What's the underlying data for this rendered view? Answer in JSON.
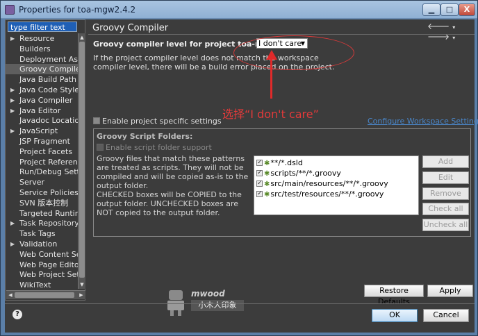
{
  "window": {
    "title": "Properties for toa-mgw2.4.2",
    "minimize_label": "▁",
    "maximize_label": "□",
    "close_label": "X"
  },
  "filter": {
    "text": "type filter text"
  },
  "tree": {
    "items": [
      {
        "label": "Resource",
        "expandable": true
      },
      {
        "label": "Builders",
        "expandable": false
      },
      {
        "label": "Deployment Assembly",
        "expandable": false
      },
      {
        "label": "Groovy Compiler",
        "expandable": false,
        "selected": true
      },
      {
        "label": "Java Build Path",
        "expandable": false
      },
      {
        "label": "Java Code Style",
        "expandable": true
      },
      {
        "label": "Java Compiler",
        "expandable": true
      },
      {
        "label": "Java Editor",
        "expandable": true
      },
      {
        "label": "Javadoc Location",
        "expandable": false
      },
      {
        "label": "JavaScript",
        "expandable": true
      },
      {
        "label": "JSP Fragment",
        "expandable": false
      },
      {
        "label": "Project Facets",
        "expandable": false
      },
      {
        "label": "Project References",
        "expandable": false
      },
      {
        "label": "Run/Debug Settings",
        "expandable": false
      },
      {
        "label": "Server",
        "expandable": false
      },
      {
        "label": "Service Policies",
        "expandable": false
      },
      {
        "label": "SVN 版本控制",
        "expandable": false
      },
      {
        "label": "Targeted Runtimes",
        "expandable": false
      },
      {
        "label": "Task Repository",
        "expandable": true
      },
      {
        "label": "Task Tags",
        "expandable": false
      },
      {
        "label": "Validation",
        "expandable": true
      },
      {
        "label": "Web Content Settings",
        "expandable": false
      },
      {
        "label": "Web Page Editor",
        "expandable": false
      },
      {
        "label": "Web Project Settings",
        "expandable": false
      },
      {
        "label": "WikiText",
        "expandable": false
      }
    ]
  },
  "page": {
    "title": "Groovy Compiler",
    "compiler_label": "Groovy compiler level for project toa-mgw2.4.2:",
    "compiler_value": "I don't care",
    "description": "If the project compiler level does not match the workspace compiler level, there will be a build error placed on the project.",
    "annotation": "选择“I don't care”",
    "enable_project_label": "Enable project specific settings",
    "configure_link": "Configure Workspace Settings...",
    "group_title": "Groovy Script Folders:",
    "enable_folder_label": "Enable script folder support",
    "help_text_1": "Groovy files that match these patterns are treated as scripts.  They will not be compiled and will be copied as-is to the output folder.",
    "help_text_2": "CHECKED boxes will be COPIED to the output folder.  UNCHECKED boxes are NOT copied to the output folder.",
    "folders": [
      "**/*.dsld",
      "scripts/**/*.groovy",
      "src/main/resources/**/*.groovy",
      "src/test/resources/**/*.groovy"
    ],
    "buttons": {
      "add": "Add",
      "edit": "Edit",
      "remove": "Remove",
      "check_all": "Check all",
      "uncheck_all": "Uncheck all"
    },
    "restore_defaults": "Restore Defaults",
    "apply": "Apply"
  },
  "footer": {
    "help": "?",
    "ok": "OK",
    "cancel": "Cancel"
  },
  "watermark": {
    "brand": "mwood",
    "sub": "小木人印象"
  }
}
